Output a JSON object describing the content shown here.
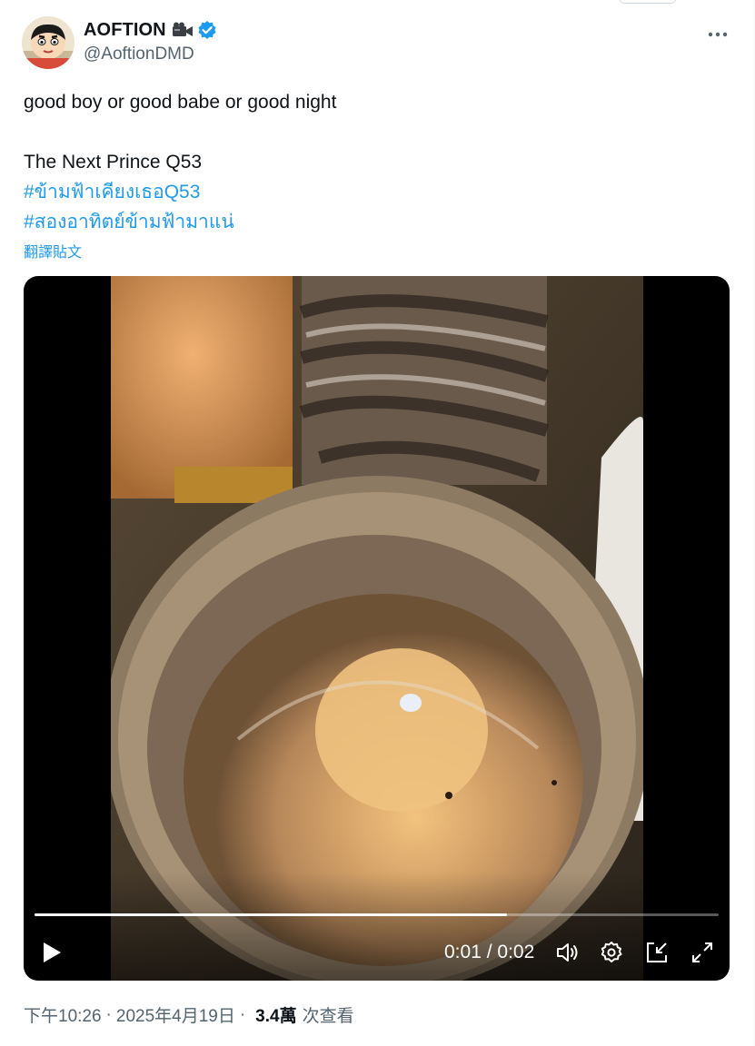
{
  "user": {
    "display_name": "AOFTION",
    "handle": "@AoftionDMD"
  },
  "tweet": {
    "line1": "good boy or good babe or good night",
    "line2": "The Next Prince Q53",
    "hashtag1": "#ข้ามฟ้าเคียงเธอQ53",
    "hashtag2": "#สองอาทิตย์ข้ามฟ้ามาแน่",
    "translate_label": "翻譯貼文"
  },
  "video": {
    "current_time": "0:01",
    "separator": "/",
    "duration": "0:02",
    "progress_fraction": 0.69
  },
  "meta": {
    "time": "下午10:26",
    "dot1": "·",
    "date": "2025年4月19日",
    "dot2": "·",
    "views_count": "3.4萬",
    "views_label": "次查看"
  },
  "icons": {
    "verified": "verified-badge-icon",
    "camera": "video-camera-emoji-icon",
    "more": "more-horizontal-icon",
    "play": "play-icon",
    "volume": "volume-icon",
    "settings": "settings-icon",
    "pip": "picture-in-picture-icon",
    "fullscreen": "fullscreen-icon"
  },
  "colors": {
    "accent": "#1d9bf0",
    "text": "#0f1419",
    "secondary": "#536471"
  }
}
